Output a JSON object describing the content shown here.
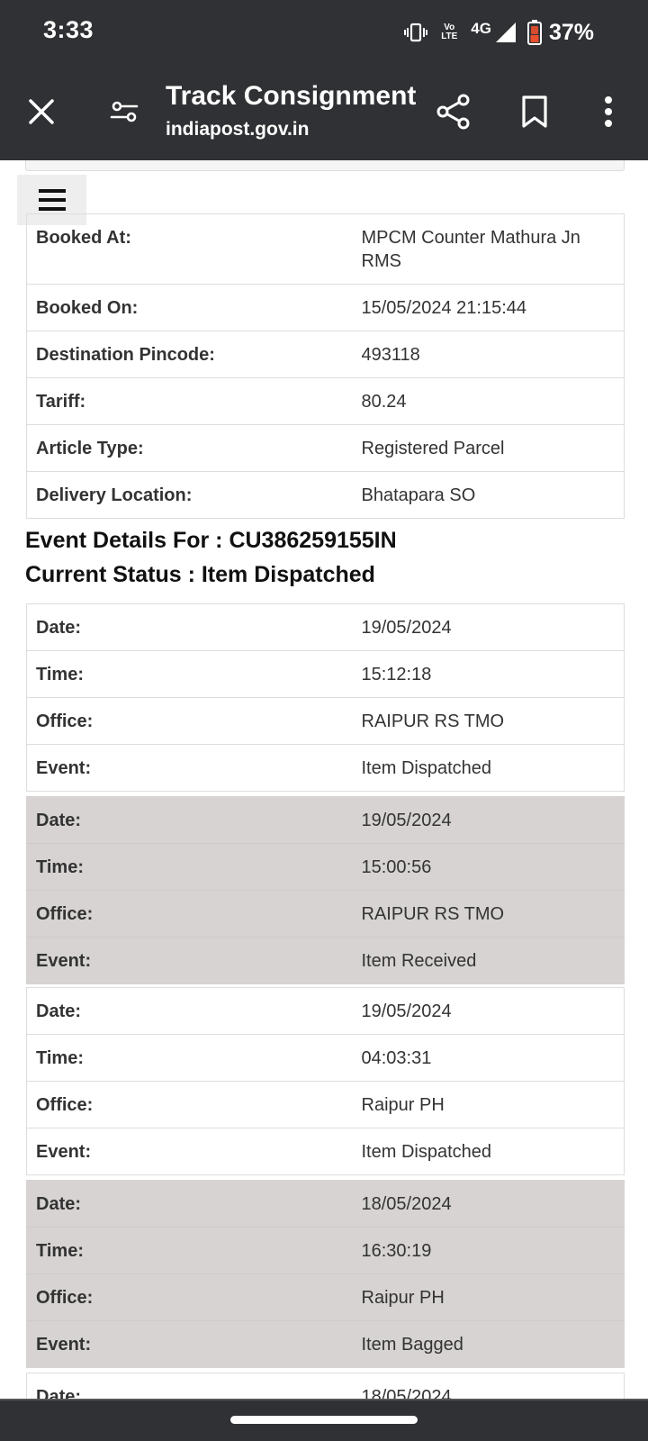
{
  "status_bar": {
    "time": "3:33",
    "network": "4G",
    "lte_label": "Vo LTE",
    "battery": "37%",
    "icons": [
      "vibrate-icon",
      "volte-icon",
      "signal-icon",
      "battery-icon"
    ]
  },
  "toolbar": {
    "title": "Track Consignment",
    "url": "indiapost.gov.in",
    "icons": [
      "close-icon",
      "tune-icon",
      "share-icon",
      "bookmark-icon",
      "more-vert-icon"
    ]
  },
  "booking": [
    {
      "label": "Booked At:",
      "value": "MPCM Counter Mathura Jn RMS"
    },
    {
      "label": "Booked On:",
      "value": "15/05/2024 21:15:44"
    },
    {
      "label": "Destination Pincode:",
      "value": "493118"
    },
    {
      "label": "Tariff:",
      "value": "80.24"
    },
    {
      "label": "Article Type:",
      "value": "Registered Parcel"
    },
    {
      "label": "Delivery Location:",
      "value": "Bhatapara SO"
    }
  ],
  "event_details_heading": "Event Details For : CU386259155IN",
  "current_status_heading": "Current Status : Item Dispatched",
  "labels": {
    "date": "Date:",
    "time": "Time:",
    "office": "Office:",
    "event": "Event:"
  },
  "events": [
    {
      "date": "19/05/2024",
      "time": "15:12:18",
      "office": "RAIPUR RS TMO",
      "event": "Item Dispatched"
    },
    {
      "date": "19/05/2024",
      "time": "15:00:56",
      "office": "RAIPUR RS TMO",
      "event": "Item Received"
    },
    {
      "date": "19/05/2024",
      "time": "04:03:31",
      "office": "Raipur PH",
      "event": "Item Dispatched"
    },
    {
      "date": "18/05/2024",
      "time": "16:30:19",
      "office": "Raipur PH",
      "event": "Item Bagged"
    },
    {
      "date": "18/05/2024"
    }
  ],
  "colors": {
    "chrome": "#303134",
    "alt_row": "#d6d3d2",
    "border": "#dddddd"
  }
}
